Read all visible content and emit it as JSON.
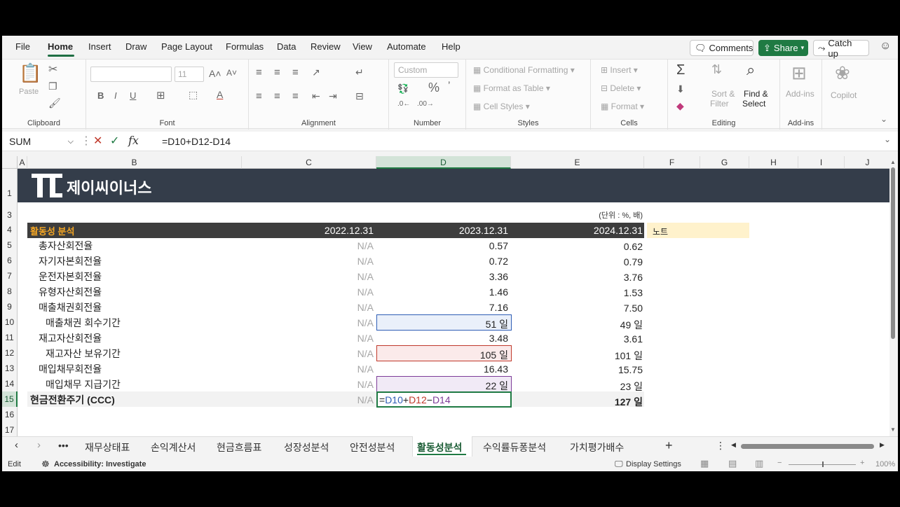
{
  "menu": {
    "items": [
      "File",
      "Home",
      "Insert",
      "Draw",
      "Page Layout",
      "Formulas",
      "Data",
      "Review",
      "View",
      "Automate",
      "Help"
    ],
    "comments": "Comments",
    "share": "Share",
    "catch_up": "Catch up"
  },
  "ribbon": {
    "clipboard": {
      "paste": "Paste",
      "label": "Clipboard"
    },
    "font": {
      "size": "11",
      "label": "Font"
    },
    "alignment": {
      "label": "Alignment"
    },
    "number": {
      "format": "Custom",
      "label": "Number"
    },
    "styles": {
      "conditional": "Conditional Formatting",
      "table": "Format as Table",
      "cell": "Cell Styles",
      "label": "Styles"
    },
    "cells": {
      "insert": "Insert",
      "delete": "Delete",
      "format": "Format",
      "label": "Cells"
    },
    "editing": {
      "sort1": "Sort &",
      "sort2": "Filter",
      "find1": "Find &",
      "find2": "Select",
      "label": "Editing"
    },
    "addins": {
      "btn": "Add-ins",
      "label": "Add-ins"
    },
    "copilot": {
      "btn": "Copilot"
    }
  },
  "formula_bar": {
    "name_box": "SUM",
    "formula": "=D10+D12-D14"
  },
  "columns": [
    "A",
    "B",
    "C",
    "D",
    "E",
    "F",
    "G",
    "H",
    "I",
    "J"
  ],
  "rows": [
    "1",
    "3",
    "4",
    "5",
    "6",
    "7",
    "8",
    "9",
    "10",
    "11",
    "12",
    "13",
    "14",
    "15",
    "16",
    "17"
  ],
  "sheet": {
    "logo_text": "제이씨이너스",
    "unit_note": "(단위 : %, 배)",
    "header": {
      "title": "활동성 분석",
      "c": "2022.12.31",
      "d": "2023.12.31",
      "e": "2024.12.31",
      "note": "노트"
    },
    "data_rows": [
      {
        "label": "총자산회전율",
        "c": "N/A",
        "d": "0.57",
        "e": "0.62"
      },
      {
        "label": "자기자본회전율",
        "c": "N/A",
        "d": "0.72",
        "e": "0.79"
      },
      {
        "label": "운전자본회전율",
        "c": "N/A",
        "d": "3.36",
        "e": "3.76"
      },
      {
        "label": "유형자산회전율",
        "c": "N/A",
        "d": "1.46",
        "e": "1.53"
      },
      {
        "label": "매출채권회전율",
        "c": "N/A",
        "d": "7.16",
        "e": "7.50"
      },
      {
        "label": "매출채권 회수기간",
        "c": "N/A",
        "d": "51 일",
        "e": "49 일"
      },
      {
        "label": "재고자산회전율",
        "c": "N/A",
        "d": "3.48",
        "e": "3.61"
      },
      {
        "label": "재고자산 보유기간",
        "c": "N/A",
        "d": "105 일",
        "e": "101 일"
      },
      {
        "label": "매입채무회전율",
        "c": "N/A",
        "d": "16.43",
        "e": "15.75"
      },
      {
        "label": "매입채무 지급기간",
        "c": "N/A",
        "d": "22 일",
        "e": "23 일"
      },
      {
        "label": "현금전환주기 (CCC)",
        "c": "N/A",
        "d": "",
        "e": "127 일"
      }
    ],
    "edit_formula": {
      "eq": "=",
      "ref1": "D10",
      "plus": "+",
      "ref2": "D12",
      "minus": "−",
      "ref3": "D14"
    }
  },
  "tabs": [
    "재무상태표",
    "손익계산서",
    "현금흐름표",
    "성장성분석",
    "안전성분석",
    "활동성분석",
    "수익률듀퐁분석",
    "가치평가배수"
  ],
  "status": {
    "mode": "Edit",
    "accessibility": "Accessibility: Investigate",
    "display": "Display Settings",
    "zoom": "100%"
  },
  "colors": {
    "accent": "#1f7a43",
    "banner": "#343d4a",
    "title": "#f5a623",
    "note_bg": "#fff2cc",
    "ref_blue": "#2e5db5",
    "ref_red": "#c0392b",
    "ref_purple": "#7d3c98"
  }
}
